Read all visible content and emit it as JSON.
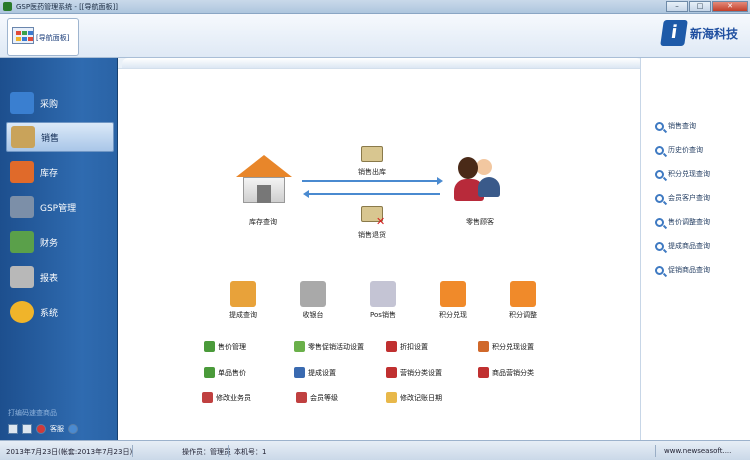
{
  "window": {
    "title": "GSP医药管理系统 - [[导航面板]]",
    "min": "–",
    "max": "□",
    "close": "✕"
  },
  "topbar": {
    "tab_label": "[导航面板]",
    "brand_text": "新海科技",
    "brand_logo": "i"
  },
  "sidebar": {
    "items": [
      {
        "label": "采购",
        "icon": "truck-icon",
        "color": "#3a7fd0"
      },
      {
        "label": "销售",
        "icon": "cart-icon",
        "color": "#c9a35a"
      },
      {
        "label": "库存",
        "icon": "house-icon",
        "color": "#e06a2a"
      },
      {
        "label": "GSP管理",
        "icon": "document-icon",
        "color": "#7c8fa8"
      },
      {
        "label": "财务",
        "icon": "chart-icon",
        "color": "#5aa04a"
      },
      {
        "label": "报表",
        "icon": "report-icon",
        "color": "#b8b8b8"
      },
      {
        "label": "系统",
        "icon": "gear-icon",
        "color": "#f0b42a"
      }
    ],
    "hint": "打编码速查商品",
    "service_label": "客服"
  },
  "flow": {
    "warehouse_label": "库存查询",
    "customer_label": "零售顾客",
    "sale_out_label": "销售出库",
    "sale_return_label": "销售退货"
  },
  "icon_row": [
    {
      "label": "提成查询",
      "icon": "folder-person-icon",
      "color": "#e8a23a"
    },
    {
      "label": "收银台",
      "icon": "cash-register-icon",
      "color": "#a9a9a9"
    },
    {
      "label": "Pos销售",
      "icon": "pos-terminal-icon",
      "color": "#c4c4d4"
    },
    {
      "label": "积分兑现",
      "icon": "gift-icon",
      "color": "#f08a2a"
    },
    {
      "label": "积分调整",
      "icon": "gift-icon",
      "color": "#f08a2a"
    }
  ],
  "functions": [
    {
      "label": "售价管理",
      "icon": "price-icon",
      "color": "#4a9a3a"
    },
    {
      "label": "零售促销活动设置",
      "icon": "promo-icon",
      "color": "#6ab04a"
    },
    {
      "label": "折扣设置",
      "icon": "discount-icon",
      "color": "#c03030"
    },
    {
      "label": "积分兑现设置",
      "icon": "points-icon",
      "color": "#d0682a"
    },
    {
      "label": "单品售价",
      "icon": "single-price-icon",
      "color": "#4a9a3a"
    },
    {
      "label": "提成设置",
      "icon": "commission-icon",
      "color": "#3a6ab0"
    },
    {
      "label": "营销分类设置",
      "icon": "marketing-icon",
      "color": "#c03030"
    },
    {
      "label": "商品营销分类",
      "icon": "category-icon",
      "color": "#c03030"
    },
    {
      "label": "修改业务员",
      "icon": "salesman-icon",
      "color": "#c04040"
    },
    {
      "label": "会员等级",
      "icon": "member-icon",
      "color": "#c04040"
    },
    {
      "label": "修改记账日期",
      "icon": "calendar-icon",
      "color": "#e8b84a"
    }
  ],
  "right_panel": {
    "items": [
      "销售查询",
      "历史价查询",
      "积分兑现查询",
      "会员客户查询",
      "售价调整查询",
      "提成商品查询",
      "促销商品查询"
    ]
  },
  "status": {
    "date": "2013年7月23日(帐套:2013年7月23日)",
    "operator": "操作员：管理员",
    "machine": "本机号：1",
    "site": "www.newseasoft...."
  }
}
